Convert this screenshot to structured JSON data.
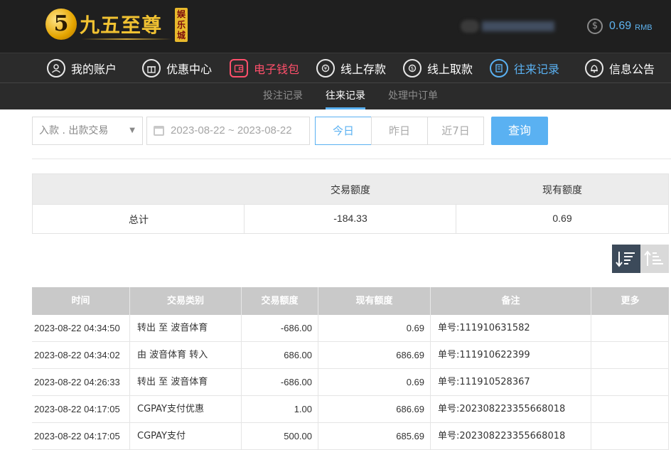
{
  "brand": {
    "logo_mark": "5",
    "name": "九五至尊",
    "badge": "娱乐城"
  },
  "account": {
    "balance_icon": "dollar-icon",
    "balance_value": "0.69",
    "balance_unit": "RMB"
  },
  "mainnav": [
    {
      "label": "我的账户",
      "icon": "user-icon",
      "state": "normal"
    },
    {
      "label": "优惠中心",
      "icon": "gift-icon",
      "state": "normal"
    },
    {
      "label": "电子钱包",
      "icon": "wallet-icon",
      "state": "highlight"
    },
    {
      "label": "线上存款",
      "icon": "deposit-icon",
      "state": "normal"
    },
    {
      "label": "线上取款",
      "icon": "withdraw-icon",
      "state": "normal"
    },
    {
      "label": "往来记录",
      "icon": "records-icon",
      "state": "active"
    },
    {
      "label": "信息公告",
      "icon": "bell-icon",
      "state": "normal"
    }
  ],
  "subnav": [
    {
      "label": "投注记录",
      "active": false
    },
    {
      "label": "往来记录",
      "active": true
    },
    {
      "label": "处理中订单",
      "active": false
    }
  ],
  "filter": {
    "type_value": "入款 . 出款交易",
    "date_range": "2023-08-22 ~ 2023-08-22",
    "ranges": [
      "今日",
      "昨日",
      "近7日"
    ],
    "active_range": "今日",
    "query_label": "查询"
  },
  "summary": {
    "headers": [
      "",
      "交易额度",
      "现有额度"
    ],
    "row": [
      "总计",
      "-184.33",
      "0.69"
    ]
  },
  "table": {
    "headers": [
      "时间",
      "交易类别",
      "交易额度",
      "现有额度",
      "备注",
      "更多"
    ],
    "rows": [
      [
        "2023-08-22 04:34:50",
        "转出 至 波音体育",
        "-686.00",
        "0.69",
        "单号:111910631582",
        ""
      ],
      [
        "2023-08-22 04:34:02",
        "由 波音体育 转入",
        "686.00",
        "686.69",
        "单号:111910622399",
        ""
      ],
      [
        "2023-08-22 04:26:33",
        "转出 至 波音体育",
        "-686.00",
        "0.69",
        "单号:111910528367",
        ""
      ],
      [
        "2023-08-22 04:17:05",
        "CGPAY支付优惠",
        "1.00",
        "686.69",
        "单号:202308223355668018",
        ""
      ],
      [
        "2023-08-22 04:17:05",
        "CGPAY支付",
        "500.00",
        "685.69",
        "单号:202308223355668018",
        ""
      ]
    ]
  },
  "colors": {
    "accent": "#5ab1f2",
    "highlight": "#ff4f6b",
    "header_bg": "#1f1f1f",
    "nav_bg": "#2b2b2b"
  }
}
